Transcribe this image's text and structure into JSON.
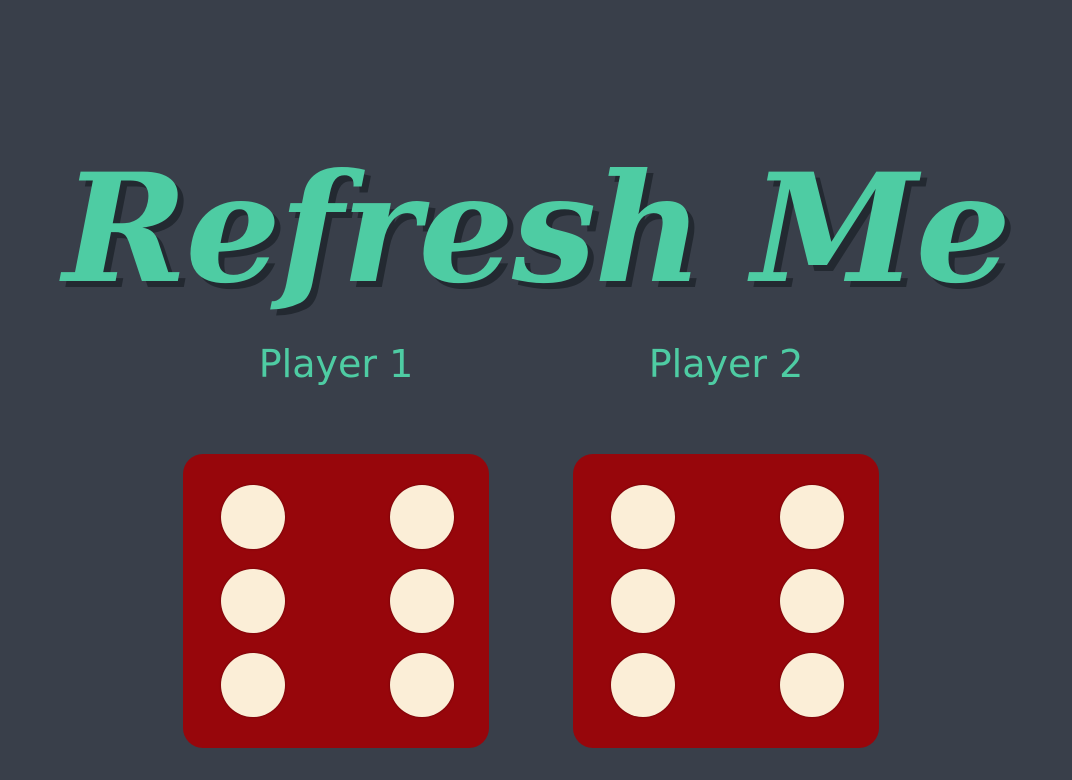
{
  "header": {
    "title": "Refresh Me"
  },
  "players": [
    {
      "label": "Player 1",
      "die_value": 6
    },
    {
      "label": "Player 2",
      "die_value": 6
    }
  ],
  "colors": {
    "background": "#393f4a",
    "accent": "#4ecca3",
    "title_shadow": "#232931",
    "die_face": "#97060b",
    "pip": "#fbeed7"
  }
}
